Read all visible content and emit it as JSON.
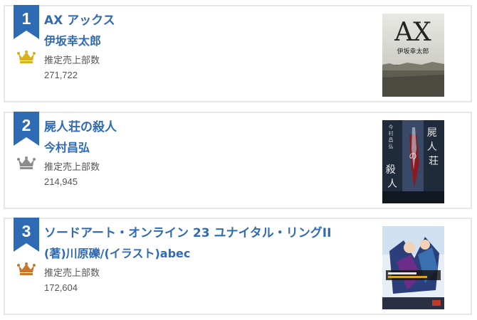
{
  "rankings": [
    {
      "rank": "1",
      "title": "AX アックス",
      "author": "伊坂幸太郎",
      "estimate_label": "推定売上部数",
      "estimate_value": "271,722",
      "crown": "gold-crown-icon",
      "cover": {
        "big_text": "AX",
        "sub_text": "伊坂幸太郎"
      }
    },
    {
      "rank": "2",
      "title": "屍人荘の殺人",
      "author": "今村昌弘",
      "estimate_label": "推定売上部数",
      "estimate_value": "214,945",
      "crown": "silver-crown-icon",
      "cover": {
        "title_chars_right": "屍人荘",
        "title_chars_left": "殺人",
        "no_char": "の",
        "author_vertical": "今村昌弘"
      }
    },
    {
      "rank": "3",
      "title": "ソードアート・オンライン 23 ユナイタル・リングII",
      "author": "(著)川原礫/(イラスト)abec",
      "estimate_label": "推定売上部数",
      "estimate_value": "172,604",
      "crown": "bronze-crown-icon"
    }
  ],
  "colors": {
    "ribbon": "#2f6bb4",
    "link": "#2f6bb4",
    "gold": "#d8b21a",
    "silver": "#8c8c8c",
    "bronze": "#c8782a",
    "border": "#e6e6e6"
  }
}
